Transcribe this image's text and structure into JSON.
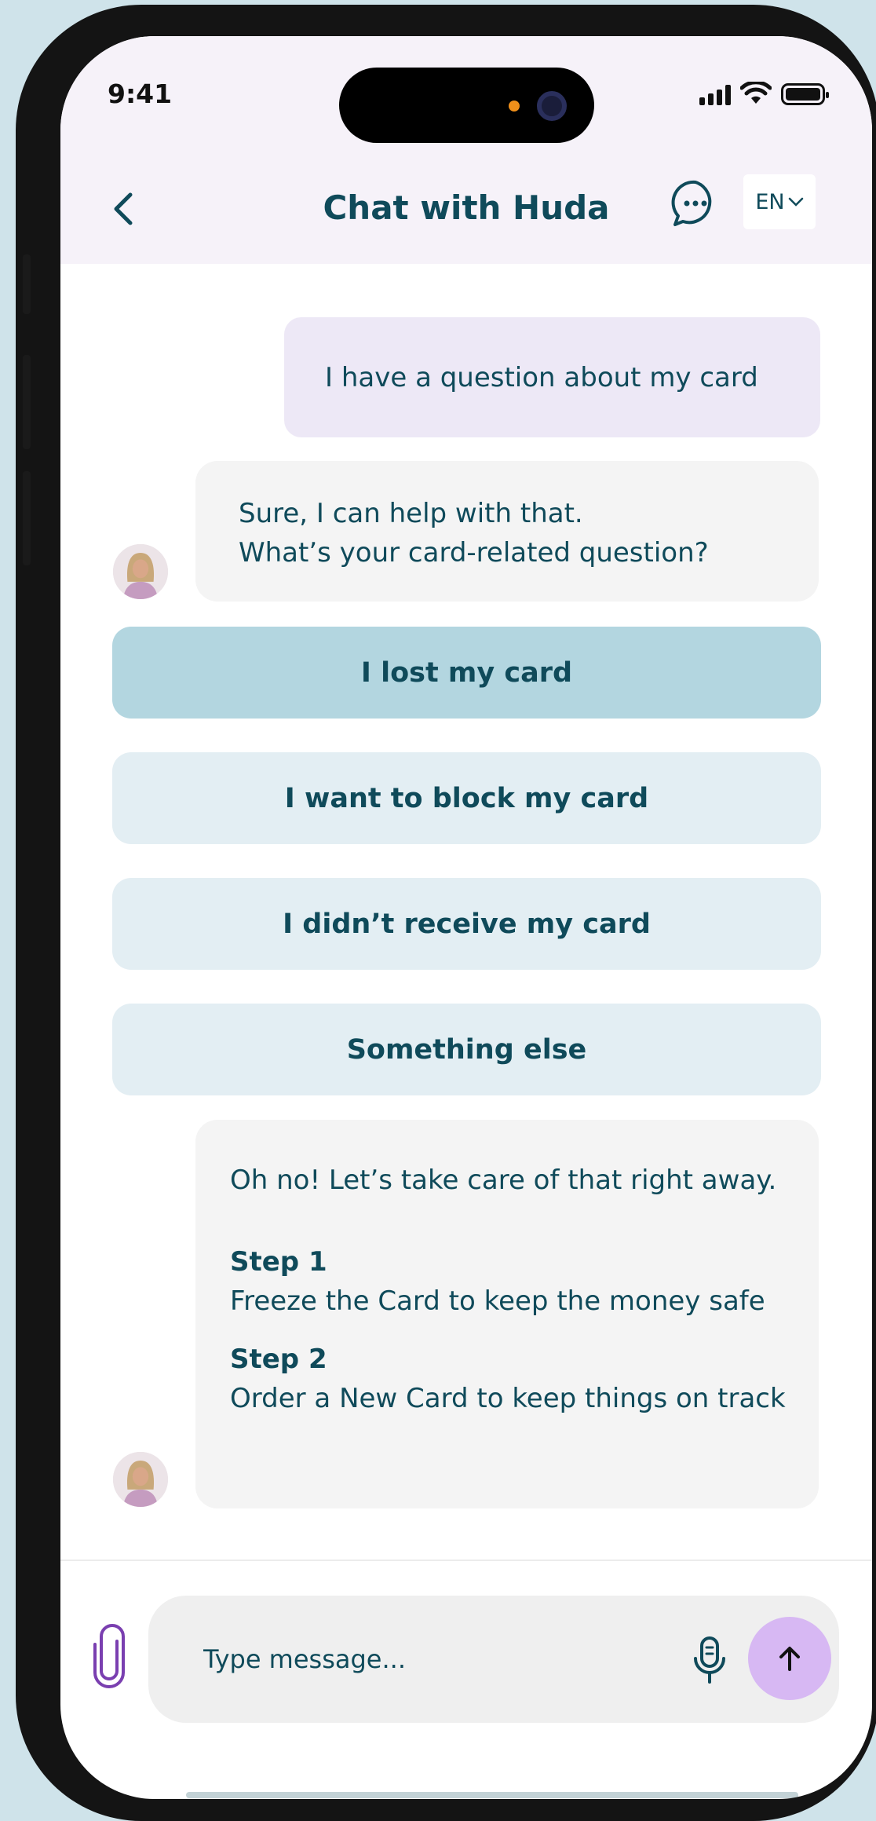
{
  "status_bar": {
    "time": "9:41"
  },
  "header": {
    "title": "Chat with Huda",
    "language": "EN"
  },
  "messages": [
    {
      "from": "user",
      "text": "I have a question about my card"
    },
    {
      "from": "bot",
      "lines": [
        "Sure, I can help with that.",
        "What’s your card-related question?"
      ]
    }
  ],
  "choices": [
    {
      "label": "I lost my card",
      "selected": true
    },
    {
      "label": "I want to block my card",
      "selected": false
    },
    {
      "label": "I didn’t receive my card",
      "selected": false
    },
    {
      "label": "Something else",
      "selected": false
    }
  ],
  "bot_reply": {
    "intro": "Oh no! Let’s take care of that right away.",
    "steps": [
      {
        "title": "Step 1",
        "text": "Freeze the Card to keep the money safe"
      },
      {
        "title": "Step 2",
        "text": "Order a New Card to keep things on track"
      }
    ]
  },
  "composer": {
    "placeholder": "Type message..."
  },
  "icons": {
    "back": "chevron-left-icon",
    "chat": "chat-bubble-icon",
    "language_caret": "chevron-down-icon",
    "attach": "paperclip-icon",
    "mic": "microphone-icon",
    "send": "arrow-up-icon"
  },
  "colors": {
    "brand_text": "#0f4a5a",
    "header_bg": "#f6f2f9",
    "user_bubble": "#ede8f6",
    "bot_bubble": "#f4f4f4",
    "choice_selected": "#b3d6e0",
    "choice": "#e3eef3",
    "send_button": "#d7b8f3",
    "attach_icon": "#7a3fb0"
  }
}
